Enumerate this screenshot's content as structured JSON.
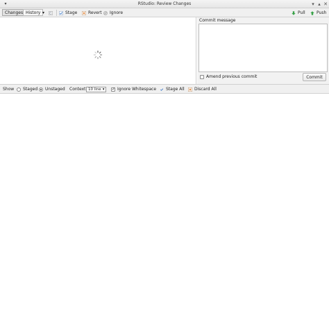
{
  "window": {
    "title": "RStudio: Review Changes"
  },
  "toolbar": {
    "tab_changes": "Changes",
    "tab_history": "History",
    "stage_label": "Stage",
    "revert_label": "Revert",
    "ignore_label": "Ignore",
    "pull_label": "Pull",
    "push_label": "Push"
  },
  "commit": {
    "message_label": "Commit message",
    "message_value": "",
    "amend_label": "Amend previous commit",
    "commit_button": "Commit"
  },
  "options": {
    "show_label": "Show",
    "staged_label": "Staged",
    "unstaged_label": "Unstaged",
    "context_label": "Context",
    "context_value": "10 line",
    "ignore_whitespace_label": "Ignore Whitespace",
    "stage_all_label": "Stage All",
    "discard_all_label": "Discard All"
  },
  "colors": {
    "accent_green": "#3aa24a",
    "check_blue": "#3b78c8",
    "revert_orange": "#e07b28",
    "ignore_gray": "#9a9a9a"
  },
  "icons": [
    "menu-icon",
    "minimize-icon",
    "maximize-icon",
    "close-icon",
    "refresh-icon",
    "stage-check-icon",
    "revert-icon",
    "ignore-icon",
    "pull-arrow-icon",
    "push-arrow-icon",
    "loading-spinner-icon",
    "stage-all-icon",
    "discard-all-icon"
  ]
}
